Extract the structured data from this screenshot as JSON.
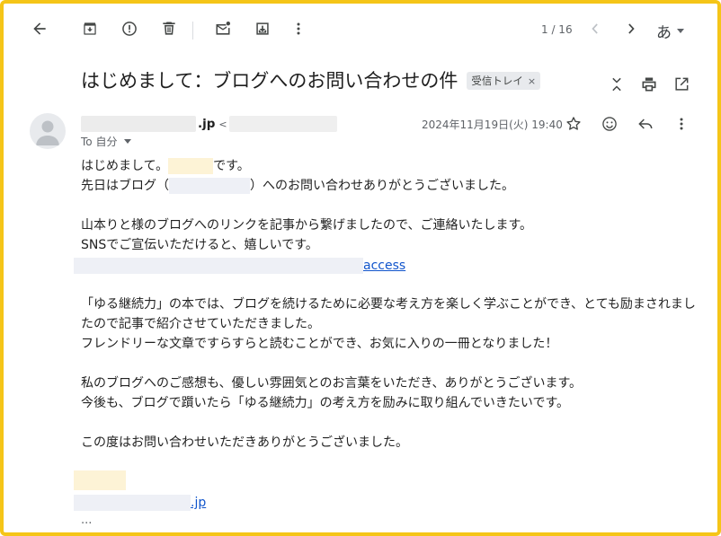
{
  "toolbar": {
    "back_icon": "arrow-left-icon",
    "archive_icon": "archive-icon",
    "spam_icon": "report-spam-icon",
    "delete_icon": "trash-icon",
    "mark_unread_icon": "mail-unread-icon",
    "move_icon": "move-to-icon",
    "more_icon": "more-vert-icon",
    "pager": "1 / 16",
    "lang": "あ"
  },
  "email": {
    "subject": "はじめまして：ブログへのお問い合わせの件",
    "label": "受信トレイ",
    "label_close": "×",
    "sender_domain": ".jp",
    "sender_lt": "<",
    "to": "To 自分",
    "date": "2024年11月19日(火) 19:40"
  },
  "body": {
    "l1a": "はじめまして。",
    "l1b": "です。",
    "l2a": "先日はブログ（",
    "l2b": "）へのお問い合わせありがとうございました。",
    "l3": "山本りと様のブログへのリンクを記事から繋げましたので、ご連絡いたします。",
    "l4": "SNSでご宣伝いただけると、嬉しいです。",
    "link_tail": "access",
    "l5": "「ゆる継続力」の本では、ブログを続けるために必要な考え方を楽しく学ぶことができ、とても励まされましたので記事で紹介させていただきました。",
    "l6": "フレンドリーな文章ですらすらと読むことができ、お気に入りの一冊となりました！",
    "l7": "私のブログへのご感想も、優しい雰囲気とのお言葉をいただき、ありがとうございます。",
    "l8": "今後も、ブログで躓いたら「ゆる継続力」の考え方を励みに取り組んでいきたいです。",
    "l9": "この度はお問い合わせいただきありがとうございました。",
    "sig_link": ".jp",
    "ellipsis": "..."
  }
}
